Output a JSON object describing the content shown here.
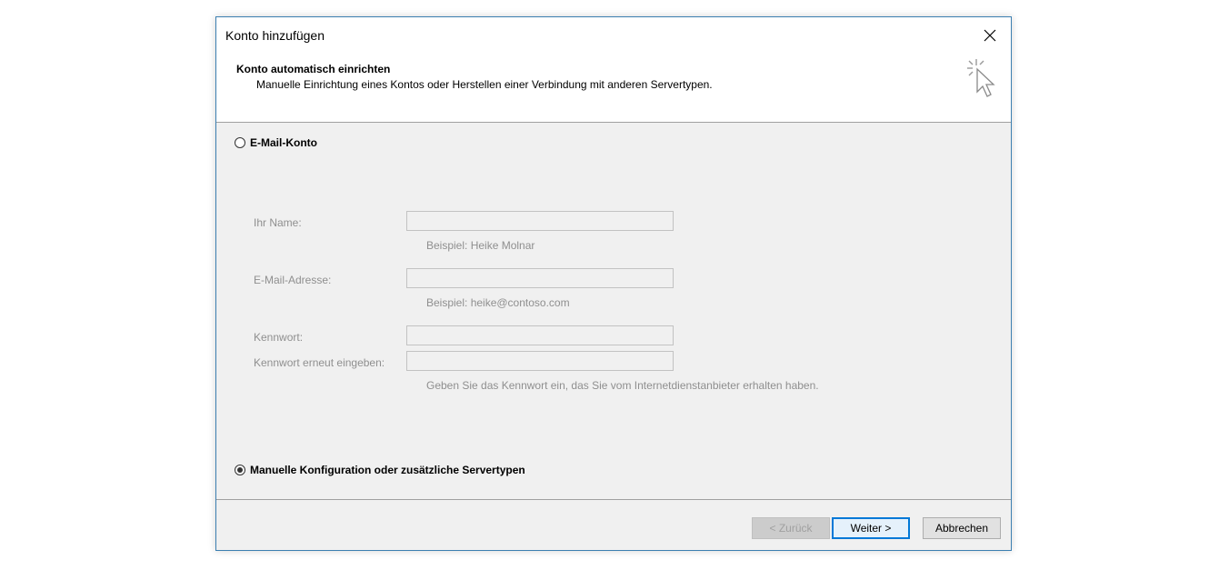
{
  "dialog": {
    "title": "Konto hinzufügen",
    "close_icon": "close-icon"
  },
  "header": {
    "title": "Konto automatisch einrichten",
    "subtitle": "Manuelle Einrichtung eines Kontos oder Herstellen einer Verbindung mit anderen Servertypen.",
    "icon": "cursor-click-icon"
  },
  "email_option": {
    "label": "E-Mail-Konto",
    "checked": false
  },
  "form": {
    "name_label": "Ihr Name:",
    "name_value": "",
    "name_hint": "Beispiel: Heike Molnar",
    "email_label": "E-Mail-Adresse:",
    "email_value": "",
    "email_hint": "Beispiel: heike@contoso.com",
    "password_label": "Kennwort:",
    "password_value": "",
    "password_repeat_label": "Kennwort erneut eingeben:",
    "password_repeat_value": "",
    "password_hint": "Geben Sie das Kennwort ein, das Sie vom Internetdienstanbieter erhalten haben."
  },
  "manual_option": {
    "label": "Manuelle Konfiguration oder zusätzliche Servertypen",
    "checked": true
  },
  "buttons": {
    "back": "< Zurück",
    "next": "Weiter >",
    "cancel": "Abbrechen"
  },
  "colors": {
    "accent": "#0078d7",
    "border": "#3c7fb1",
    "disabled_text": "#8f8f8f"
  }
}
